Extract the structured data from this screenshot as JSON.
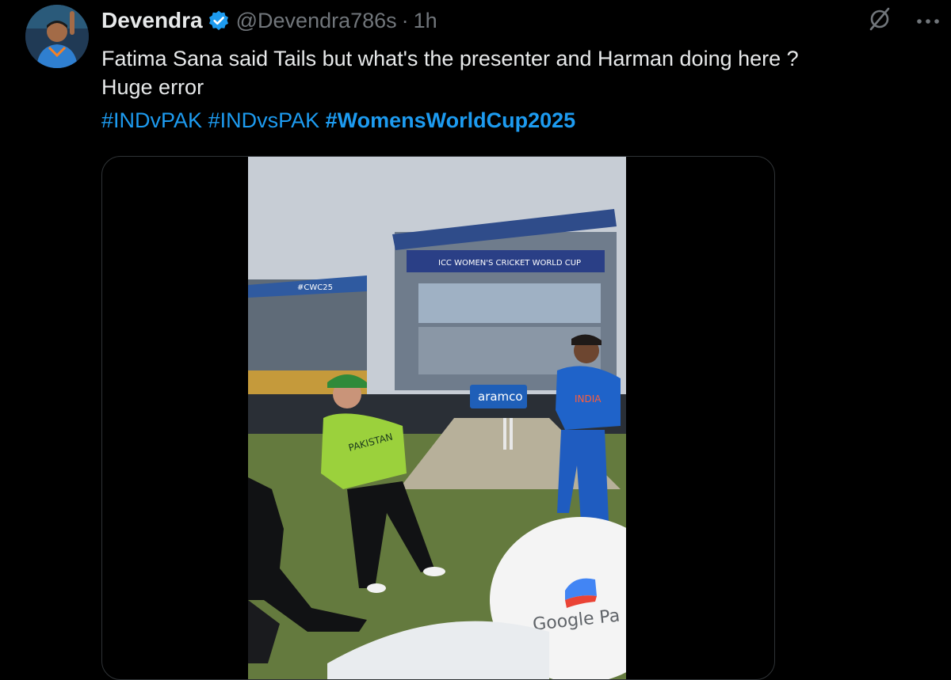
{
  "author": {
    "name": "Devendra",
    "handle": "@Devendra786s",
    "separator": "·",
    "time": "1h",
    "verified": true,
    "avatar_icon": "avatar-icon"
  },
  "actions": {
    "grok_icon": "grok-slash-icon",
    "more_label": "···"
  },
  "tweet": {
    "line1": "Fatima Sana said Tails but what's the presenter and Harman doing here ?",
    "line2": "Huge error",
    "hashtags": [
      "#INDvPAK",
      "#INDvsPAK",
      "#WomensWorldCup2025"
    ]
  },
  "media": {
    "type": "video",
    "scene_text": {
      "upper_banner": "ICC WOMEN'S CRICKET WORLD CUP",
      "left_banner": "#CWC25",
      "board": "aramco",
      "sponsor": "Google Pa",
      "jersey_left": "PAKISTAN",
      "jersey_right": "INDIA"
    }
  },
  "colors": {
    "background": "#000000",
    "text": "#e7e9ea",
    "muted": "#71767b",
    "link": "#1d9bf0",
    "verified": "#1d9bf0"
  }
}
